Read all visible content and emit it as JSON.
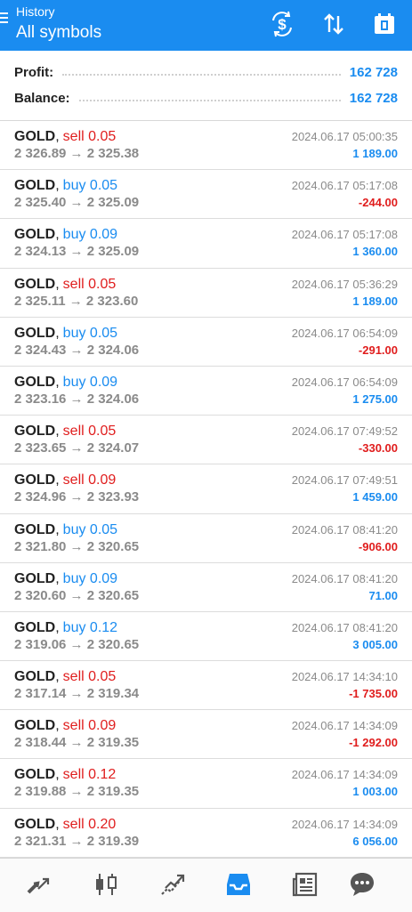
{
  "header": {
    "subtitle": "History",
    "title": "All symbols",
    "background": "#1a8cf0"
  },
  "summary": {
    "profit_label": "Profit:",
    "profit_value": "162 728",
    "balance_label": "Balance:",
    "balance_value": "162 728"
  },
  "colors": {
    "buy": "#1a8cf0",
    "sell": "#e01d1d",
    "positive": "#1a8cf0",
    "negative": "#e01d1d"
  },
  "trades": [
    {
      "symbol": "GOLD",
      "type": "sell",
      "volume": "0.05",
      "open": "2 326.89",
      "close": "2 325.38",
      "time": "2024.06.17 05:00:35",
      "profit": "1 189.00"
    },
    {
      "symbol": "GOLD",
      "type": "buy",
      "volume": "0.05",
      "open": "2 325.40",
      "close": "2 325.09",
      "time": "2024.06.17 05:17:08",
      "profit": "-244.00"
    },
    {
      "symbol": "GOLD",
      "type": "buy",
      "volume": "0.09",
      "open": "2 324.13",
      "close": "2 325.09",
      "time": "2024.06.17 05:17:08",
      "profit": "1 360.00"
    },
    {
      "symbol": "GOLD",
      "type": "sell",
      "volume": "0.05",
      "open": "2 325.11",
      "close": "2 323.60",
      "time": "2024.06.17 05:36:29",
      "profit": "1 189.00"
    },
    {
      "symbol": "GOLD",
      "type": "buy",
      "volume": "0.05",
      "open": "2 324.43",
      "close": "2 324.06",
      "time": "2024.06.17 06:54:09",
      "profit": "-291.00"
    },
    {
      "symbol": "GOLD",
      "type": "buy",
      "volume": "0.09",
      "open": "2 323.16",
      "close": "2 324.06",
      "time": "2024.06.17 06:54:09",
      "profit": "1 275.00"
    },
    {
      "symbol": "GOLD",
      "type": "sell",
      "volume": "0.05",
      "open": "2 323.65",
      "close": "2 324.07",
      "time": "2024.06.17 07:49:52",
      "profit": "-330.00"
    },
    {
      "symbol": "GOLD",
      "type": "sell",
      "volume": "0.09",
      "open": "2 324.96",
      "close": "2 323.93",
      "time": "2024.06.17 07:49:51",
      "profit": "1 459.00"
    },
    {
      "symbol": "GOLD",
      "type": "buy",
      "volume": "0.05",
      "open": "2 321.80",
      "close": "2 320.65",
      "time": "2024.06.17 08:41:20",
      "profit": "-906.00"
    },
    {
      "symbol": "GOLD",
      "type": "buy",
      "volume": "0.09",
      "open": "2 320.60",
      "close": "2 320.65",
      "time": "2024.06.17 08:41:20",
      "profit": "71.00"
    },
    {
      "symbol": "GOLD",
      "type": "buy",
      "volume": "0.12",
      "open": "2 319.06",
      "close": "2 320.65",
      "time": "2024.06.17 08:41:20",
      "profit": "3 005.00"
    },
    {
      "symbol": "GOLD",
      "type": "sell",
      "volume": "0.05",
      "open": "2 317.14",
      "close": "2 319.34",
      "time": "2024.06.17 14:34:10",
      "profit": "-1 735.00"
    },
    {
      "symbol": "GOLD",
      "type": "sell",
      "volume": "0.09",
      "open": "2 318.44",
      "close": "2 319.35",
      "time": "2024.06.17 14:34:09",
      "profit": "-1 292.00"
    },
    {
      "symbol": "GOLD",
      "type": "sell",
      "volume": "0.12",
      "open": "2 319.88",
      "close": "2 319.35",
      "time": "2024.06.17 14:34:09",
      "profit": "1 003.00"
    },
    {
      "symbol": "GOLD",
      "type": "sell",
      "volume": "0.20",
      "open": "2 321.31",
      "close": "2 319.39",
      "time": "2024.06.17 14:34:09",
      "profit": "6 056.00"
    }
  ],
  "bottom_nav": [
    {
      "icon": "quotes-icon",
      "active": false
    },
    {
      "icon": "chart-icon",
      "active": false
    },
    {
      "icon": "trade-icon",
      "active": false
    },
    {
      "icon": "history-icon",
      "active": true
    },
    {
      "icon": "news-icon",
      "active": false
    },
    {
      "icon": "messages-icon",
      "active": false
    }
  ]
}
